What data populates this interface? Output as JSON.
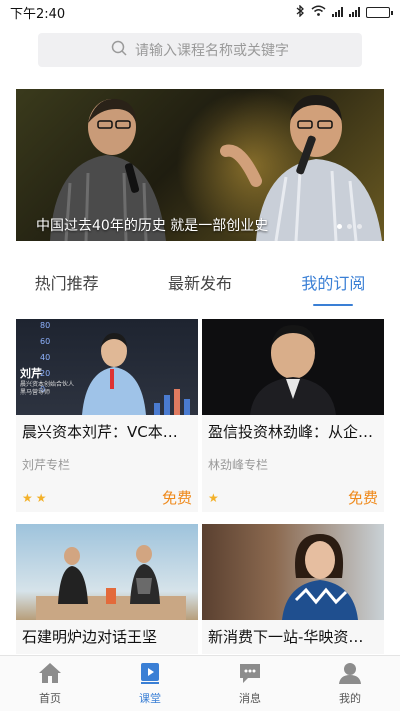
{
  "status_bar": {
    "time": "下午2:40",
    "battery_level": 0.9
  },
  "search": {
    "placeholder": "请输入课程名称或关键字"
  },
  "banner": {
    "caption": "中国过去40年的历史 就是一部创业史",
    "dots": 3,
    "active_dot": 0
  },
  "tabs": [
    {
      "label": "热门推荐",
      "active": false
    },
    {
      "label": "最新发布",
      "active": false
    },
    {
      "label": "我的订阅",
      "active": true
    }
  ],
  "courses": [
    {
      "title": "晨兴资本刘芹：VC本质是…",
      "author": "刘芹专栏",
      "stars": 2,
      "price": "免费",
      "thumb_caption": "刘芹",
      "thumb_subtitle": "晨兴资本创始合伙人\n黑马营导师",
      "thumb_axis": [
        "80",
        "60",
        "40",
        "20",
        "0"
      ]
    },
    {
      "title": "盈信投资林劲峰：从企业…",
      "author": "林劲峰专栏",
      "stars": 1,
      "price": "免费"
    },
    {
      "title": "石建明炉边对话王坚"
    },
    {
      "title": "新消费下一站-华映资本…"
    }
  ],
  "bottom_nav": [
    {
      "label": "首页",
      "icon": "home-icon",
      "active": false
    },
    {
      "label": "课堂",
      "icon": "classroom-icon",
      "active": true
    },
    {
      "label": "消息",
      "icon": "message-icon",
      "active": false
    },
    {
      "label": "我的",
      "icon": "profile-icon",
      "active": false
    }
  ],
  "colors": {
    "accent": "#3a7fd5",
    "price": "#ef8a1c",
    "star": "#f3b12a"
  }
}
